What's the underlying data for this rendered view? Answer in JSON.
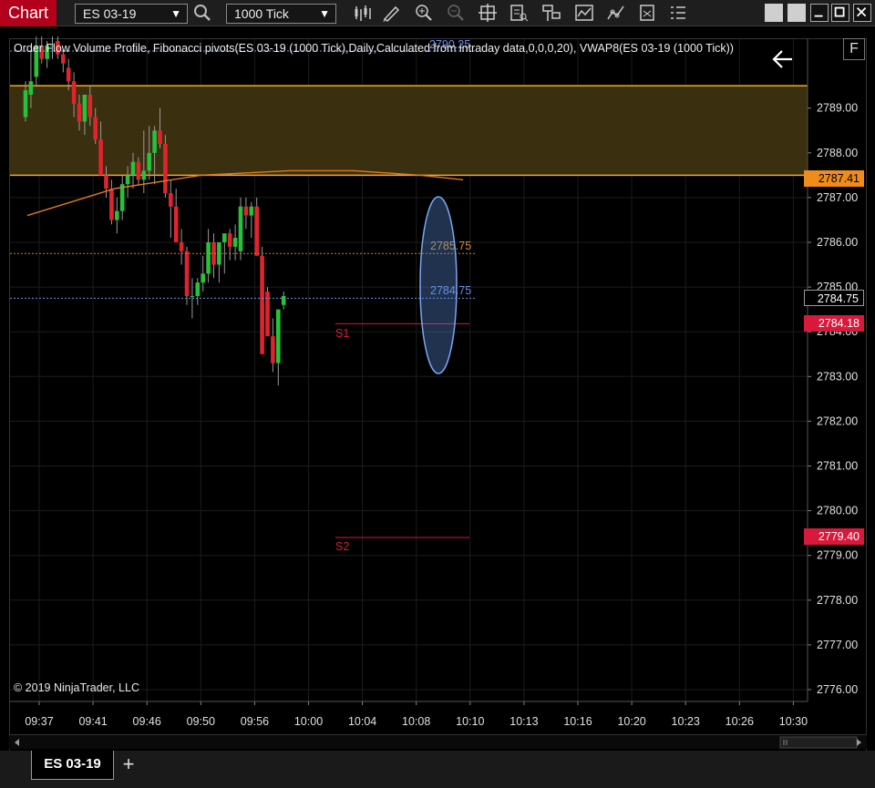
{
  "toolbar": {
    "title": "Chart",
    "instrument": "ES 03-19",
    "interval": "1000 Tick",
    "icons": [
      "search-icon",
      "bar-style-icon",
      "draw-pencil-icon",
      "zoom-in-icon",
      "zoom-out-icon",
      "crosshair-icon",
      "data-box-icon",
      "properties-icon",
      "indicators-icon",
      "strategies-icon",
      "templates-icon",
      "list-icon"
    ],
    "window_buttons": [
      "minimize-icon",
      "maximize-icon",
      "close-icon"
    ]
  },
  "chart": {
    "indicators_text": "Order Flow Volume Profile, Fibonacci pivots(ES 03-19 (1000 Tick),Daily,Calculated from intraday data,0,0,0,20), VWAP8(ES 03-19 (1000 Tick))",
    "copyright": "© 2019 NinjaTrader, LLC",
    "f_label": "F",
    "back_arrow": "arrow-left-icon",
    "level_labels": {
      "top": "2790.25",
      "orange": "2785.75",
      "blue": "2784.75",
      "s1": "S1",
      "s2": "S2"
    },
    "price_tags": {
      "r_level": "2787.41",
      "last": "2784.75",
      "s1": "2784.18",
      "s2": "2779.40"
    },
    "colors": {
      "up": "#27c13a",
      "down": "#e0242f",
      "zone_fill": "#3d3110",
      "zone_line": "#f5a623",
      "vwap": "#e07a20",
      "highlight": "#5b8fe0"
    }
  },
  "chart_data": {
    "type": "candlestick",
    "title": "",
    "xlabel": "",
    "ylabel": "",
    "y_ticks": [
      "2776.00",
      "2777.00",
      "2778.00",
      "2779.00",
      "2780.00",
      "2781.00",
      "2782.00",
      "2783.00",
      "2784.00",
      "2785.00",
      "2786.00",
      "2787.00",
      "2788.00",
      "2789.00"
    ],
    "x_ticks": [
      "09:37",
      "09:41",
      "09:46",
      "09:50",
      "09:56",
      "10:00",
      "10:04",
      "10:08",
      "10:10",
      "10:13",
      "10:16",
      "10:20",
      "10:23",
      "10:26",
      "10:30"
    ],
    "ylim": [
      2775.75,
      2790.6
    ],
    "candles": [
      {
        "o": 2788.8,
        "h": 2789.6,
        "l": 2788.7,
        "c": 2789.4
      },
      {
        "o": 2789.3,
        "h": 2790.3,
        "l": 2789.0,
        "c": 2789.6
      },
      {
        "o": 2789.7,
        "h": 2790.6,
        "l": 2789.5,
        "c": 2790.4
      },
      {
        "o": 2790.4,
        "h": 2790.6,
        "l": 2790.0,
        "c": 2790.1
      },
      {
        "o": 2790.1,
        "h": 2790.5,
        "l": 2789.9,
        "c": 2790.4
      },
      {
        "o": 2790.4,
        "h": 2790.6,
        "l": 2790.1,
        "c": 2790.4
      },
      {
        "o": 2790.5,
        "h": 2790.6,
        "l": 2790.1,
        "c": 2790.2
      },
      {
        "o": 2790.2,
        "h": 2790.3,
        "l": 2789.8,
        "c": 2790.0
      },
      {
        "o": 2789.9,
        "h": 2790.1,
        "l": 2789.4,
        "c": 2789.6
      },
      {
        "o": 2789.6,
        "h": 2789.8,
        "l": 2788.8,
        "c": 2789.1
      },
      {
        "o": 2789.1,
        "h": 2789.3,
        "l": 2788.5,
        "c": 2788.7
      },
      {
        "o": 2788.7,
        "h": 2789.3,
        "l": 2788.4,
        "c": 2789.3
      },
      {
        "o": 2789.3,
        "h": 2789.5,
        "l": 2788.6,
        "c": 2788.8
      },
      {
        "o": 2788.8,
        "h": 2789.0,
        "l": 2788.2,
        "c": 2788.3
      },
      {
        "o": 2788.3,
        "h": 2788.7,
        "l": 2787.5,
        "c": 2787.5
      },
      {
        "o": 2787.5,
        "h": 2787.7,
        "l": 2787.0,
        "c": 2787.2
      },
      {
        "o": 2787.2,
        "h": 2787.4,
        "l": 2786.4,
        "c": 2786.5
      },
      {
        "o": 2786.5,
        "h": 2787.0,
        "l": 2786.2,
        "c": 2786.7
      },
      {
        "o": 2786.7,
        "h": 2787.5,
        "l": 2786.5,
        "c": 2787.3
      },
      {
        "o": 2787.3,
        "h": 2787.7,
        "l": 2787.0,
        "c": 2787.5
      },
      {
        "o": 2787.5,
        "h": 2788.0,
        "l": 2787.2,
        "c": 2787.8
      },
      {
        "o": 2787.8,
        "h": 2787.9,
        "l": 2787.3,
        "c": 2787.4
      },
      {
        "o": 2787.4,
        "h": 2788.5,
        "l": 2787.1,
        "c": 2787.6
      },
      {
        "o": 2787.6,
        "h": 2788.6,
        "l": 2787.4,
        "c": 2788.0
      },
      {
        "o": 2788.0,
        "h": 2788.6,
        "l": 2787.3,
        "c": 2788.5
      },
      {
        "o": 2788.5,
        "h": 2789.0,
        "l": 2788.1,
        "c": 2788.2
      },
      {
        "o": 2788.2,
        "h": 2788.4,
        "l": 2787.0,
        "c": 2787.1
      },
      {
        "o": 2787.1,
        "h": 2787.4,
        "l": 2786.1,
        "c": 2786.8
      },
      {
        "o": 2786.8,
        "h": 2787.2,
        "l": 2786.0,
        "c": 2786.0
      },
      {
        "o": 2786.0,
        "h": 2786.3,
        "l": 2785.5,
        "c": 2785.8
      },
      {
        "o": 2785.8,
        "h": 2785.9,
        "l": 2784.6,
        "c": 2784.8
      },
      {
        "o": 2784.8,
        "h": 2785.2,
        "l": 2784.3,
        "c": 2784.8
      },
      {
        "o": 2784.8,
        "h": 2785.2,
        "l": 2784.6,
        "c": 2785.1
      },
      {
        "o": 2785.1,
        "h": 2785.7,
        "l": 2784.9,
        "c": 2785.3
      },
      {
        "o": 2785.3,
        "h": 2786.3,
        "l": 2785.1,
        "c": 2786.0
      },
      {
        "o": 2786.0,
        "h": 2786.2,
        "l": 2785.2,
        "c": 2785.5
      },
      {
        "o": 2785.5,
        "h": 2786.0,
        "l": 2785.1,
        "c": 2786.0
      },
      {
        "o": 2786.0,
        "h": 2786.2,
        "l": 2785.3,
        "c": 2786.2
      },
      {
        "o": 2786.2,
        "h": 2786.3,
        "l": 2785.6,
        "c": 2785.9
      },
      {
        "o": 2785.9,
        "h": 2786.4,
        "l": 2785.6,
        "c": 2786.1
      },
      {
        "o": 2785.8,
        "h": 2787.0,
        "l": 2785.6,
        "c": 2786.8
      },
      {
        "o": 2786.8,
        "h": 2787.0,
        "l": 2786.3,
        "c": 2786.6
      },
      {
        "o": 2786.6,
        "h": 2786.9,
        "l": 2786.1,
        "c": 2786.8
      },
      {
        "o": 2786.8,
        "h": 2787.0,
        "l": 2785.7,
        "c": 2785.7
      },
      {
        "o": 2785.7,
        "h": 2785.9,
        "l": 2783.5,
        "c": 2783.5
      },
      {
        "o": 2784.9,
        "h": 2785.0,
        "l": 2783.9,
        "c": 2783.9
      },
      {
        "o": 2783.9,
        "h": 2784.3,
        "l": 2783.1,
        "c": 2783.3
      },
      {
        "o": 2783.3,
        "h": 2784.5,
        "l": 2782.8,
        "c": 2784.5
      },
      {
        "o": 2784.6,
        "h": 2784.9,
        "l": 2784.5,
        "c": 2784.8
      }
    ],
    "levels": {
      "zone_top": 2789.5,
      "zone_bottom": 2787.5,
      "orange_line": 2785.75,
      "blue_line": 2784.75,
      "s1": 2784.18,
      "s2": 2779.4
    },
    "vwap": [
      [
        0,
        2786.6
      ],
      [
        0.2,
        2787.2
      ],
      [
        0.4,
        2787.5
      ],
      [
        0.6,
        2787.6
      ],
      [
        0.75,
        2787.6
      ],
      [
        0.9,
        2787.5
      ],
      [
        1.0,
        2787.4
      ]
    ]
  }
}
